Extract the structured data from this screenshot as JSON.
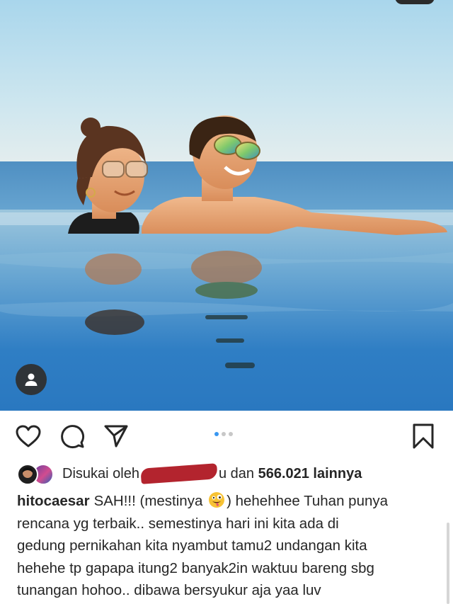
{
  "post": {
    "photo_icon": "tag-people-icon",
    "carousel": {
      "count": 3,
      "active_index": 0
    }
  },
  "actions": {
    "like_icon": "heart-icon",
    "comment_icon": "comment-icon",
    "share_icon": "send-icon",
    "save_icon": "bookmark-icon"
  },
  "likes": {
    "prefix": "Disukai oleh",
    "redacted_name": "",
    "name_tail": "u",
    "conjunction": "dan",
    "count": "566.021 lainnya"
  },
  "caption": {
    "username": "hitocaesar",
    "line1_before_emoji": "SAH!!! (mestinya ",
    "emoji": "zany-face-emoji",
    "line1_after_emoji": ") hehehhee Tuhan punya",
    "line2": "rencana yg terbaik.. semestinya hari ini kita ada di",
    "line3": "gedung pernikahan kita nyambut tamu2 undangan kita",
    "line4": "hehehe tp gapapa itung2 banyak2in waktuu bareng sbg",
    "line5": "tunangan hohoo.. dibawa bersyukur aja yaa luv"
  },
  "colors": {
    "accent_blue": "#3897f0",
    "text": "#262626",
    "redaction": "#b3242e"
  }
}
